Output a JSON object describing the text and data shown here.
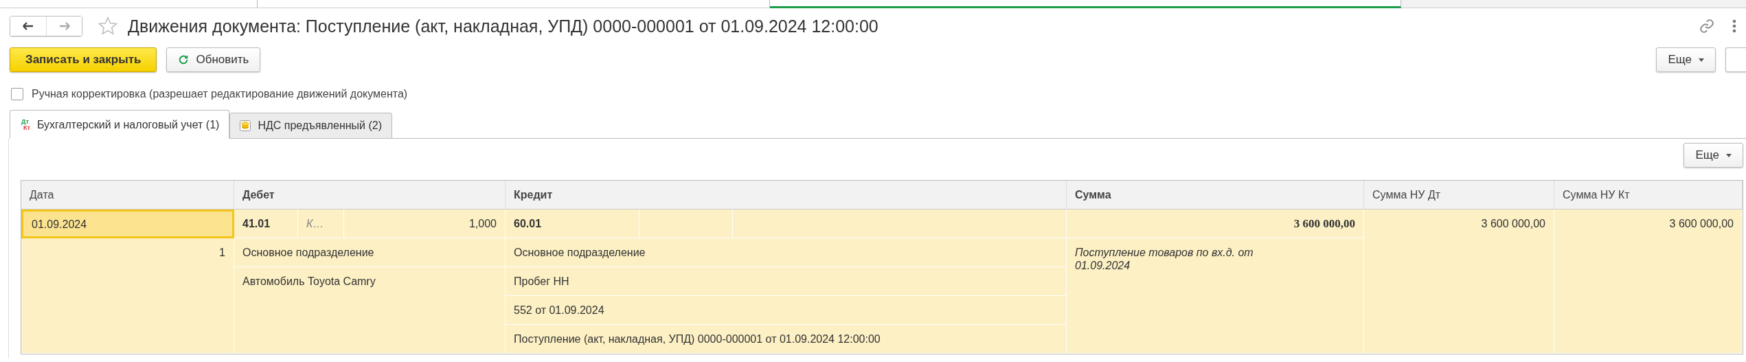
{
  "window_tabs": [
    {
      "selected": false
    },
    {
      "selected": false
    },
    {
      "selected": true
    }
  ],
  "navigation": {
    "back_disabled": false,
    "forward_disabled": true,
    "favorite": false
  },
  "window": {
    "title": "Движения документа: Поступление (акт, накладная, УПД) 0000-000001 от 01.09.2024 12:00:00"
  },
  "toolbar": {
    "primary_button": "Записать и закрыть",
    "refresh_button": "Обновить",
    "more_button": "Еще"
  },
  "manual_correction": {
    "label": "Ручная корректировка (разрешает редактирование движений документа)",
    "checked": false
  },
  "tabs": [
    {
      "label": "Бухгалтерский и налоговый учет (1)",
      "selected": true,
      "icon": {
        "kind": "dt-kt",
        "top": "Дт",
        "bottom": "Кт"
      }
    },
    {
      "label": "НДС предъявленный (2)",
      "selected": false,
      "icon": {
        "kind": "coins"
      }
    }
  ],
  "table_toolbar": {
    "more_button": "Еще"
  },
  "table": {
    "columns": [
      {
        "label": "Дата",
        "bold": false
      },
      {
        "label": "Дебет",
        "bold": true
      },
      {
        "label": "Кредит",
        "bold": true
      },
      {
        "label": "Сумма",
        "bold": true
      },
      {
        "label": "Сумма НУ Дт",
        "bold": false
      },
      {
        "label": "Сумма НУ Кт",
        "bold": false
      }
    ],
    "entry": {
      "date": {
        "text": "01.09.2024",
        "selected": true
      },
      "line_number": "1",
      "debit": {
        "account": "41.01",
        "subconto": "К…",
        "quantity": "1,000",
        "details": [
          "Основное подразделение",
          "Автомобиль Toyota Camry"
        ]
      },
      "credit": {
        "account": "60.01",
        "details": [
          "Основное подразделение",
          "Пробег НН",
          "552 от 01.09.2024",
          "Поступление (акт, накладная, УПД) 0000-000001 от 01.09.2024 12:00:00"
        ]
      },
      "amount": "3 600 000,00",
      "content": "Поступление товаров по вх.д.  от 01.09.2024",
      "amount_tax_dt": "3 600 000,00",
      "amount_tax_kt": "3 600 000,00"
    }
  }
}
